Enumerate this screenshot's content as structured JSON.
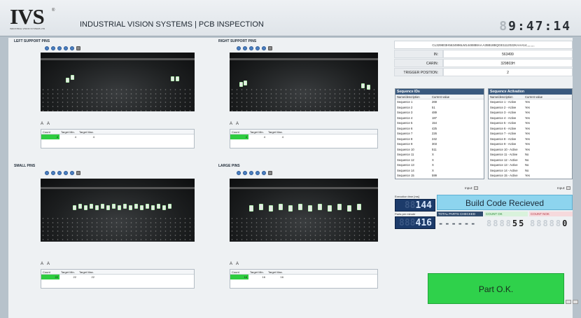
{
  "header": {
    "brand": "IVS",
    "brand_tag": "INDUSTRIAL VISION SYSTEMS LTD",
    "reg": "®",
    "title": "INDUSTRIAL VISION SYSTEMS | PCB INSPECTION",
    "clock_dim": "8",
    "clock": "9:47:14"
  },
  "panels": [
    {
      "title": "LEFT SUPPORT PINS",
      "count": "4",
      "tmin": "4",
      "tmax": "4"
    },
    {
      "title": "RIGHT SUPPORT PINS",
      "count": "4",
      "tmin": "4",
      "tmax": "4"
    },
    {
      "title": "SMALL PINS",
      "count": "22",
      "tmin": "22",
      "tmax": "22"
    },
    {
      "title": "LARGE PINS",
      "count": "16",
      "tmin": "16",
      "tmax": "16"
    }
  ],
  "table_headers": {
    "count": "Count",
    "tmin": "Target Min.",
    "tmax": "Target Max."
  },
  "info": {
    "barcode": "CL329803H5634996LM1448888AA  A35B18BQGE1112022KAAA14,,,,,,,,,",
    "in_label": "IN:",
    "in_value": "563499",
    "carin_label": "CARIN:",
    "carin_value": "329803H",
    "trigger_label": "TRIGGER POSITION:",
    "trigger_value": "2"
  },
  "seq_ids": {
    "title": "Sequence IDs",
    "h1": "Name/description",
    "h2": "Current value",
    "rows": [
      [
        "Sequence 1",
        "269"
      ],
      [
        "Sequence 2",
        "51"
      ],
      [
        "Sequence 3",
        "489"
      ],
      [
        "Sequence 4",
        "187"
      ],
      [
        "Sequence 5",
        "154"
      ],
      [
        "Sequence 6",
        "425"
      ],
      [
        "Sequence 7",
        "226"
      ],
      [
        "Sequence 8",
        "242"
      ],
      [
        "Sequence 9",
        "303"
      ],
      [
        "Sequence 10",
        "511"
      ],
      [
        "Sequence 11",
        "X"
      ],
      [
        "Sequence 12",
        "X"
      ],
      [
        "Sequence 13",
        "X"
      ],
      [
        "Sequence 14",
        "X"
      ],
      [
        "Sequence 15",
        "599"
      ]
    ],
    "input": "Input:"
  },
  "seq_act": {
    "title": "Sequence Activation",
    "h1": "Name/description",
    "h2": "Current value",
    "rows": [
      [
        "Sequence 1 - Active",
        "Yes"
      ],
      [
        "Sequence 2 - Active",
        "Yes"
      ],
      [
        "Sequence 3 - Active",
        "Yes"
      ],
      [
        "Sequence 4 - Active",
        "Yes"
      ],
      [
        "Sequence 5 - Active",
        "Yes"
      ],
      [
        "Sequence 6 - Active",
        "Yes"
      ],
      [
        "Sequence 7 - Active",
        "Yes"
      ],
      [
        "Sequence 8 - Active",
        "Yes"
      ],
      [
        "Sequence 9 - Active",
        "Yes"
      ],
      [
        "Sequence 10 - Active",
        "Yes"
      ],
      [
        "Sequence 11 - Active",
        "No"
      ],
      [
        "Sequence 12 - Active",
        "No"
      ],
      [
        "Sequence 13 - Active",
        "No"
      ],
      [
        "Sequence 14 - Active",
        "No"
      ],
      [
        "Sequence 15 - Active",
        "Yes"
      ]
    ],
    "input": "Input:"
  },
  "stats": {
    "exec_label": "Execution time [ms]",
    "exec_dim": "88",
    "exec_value": "144",
    "ppm_label": "Parts per minute",
    "ppm_dim": "888",
    "ppm_value": "416",
    "build": "Build Code Recieved",
    "total_label": "TOTAL PARTS CHECKED",
    "total_value": "------",
    "ok_label": "COUNT OK",
    "ok_dim": "8888",
    "ok_value": "55",
    "nok_label": "COUNT NOK",
    "nok_dim": "88888",
    "nok_value": "0"
  },
  "result": "Part O.K.",
  "colors": {
    "ok_green": "#2fd14b",
    "build_blue": "#8dd4ee",
    "lcd_blue": "#1c3b6a",
    "seq_title": "#39597e",
    "count_green": "#2ecc40"
  }
}
